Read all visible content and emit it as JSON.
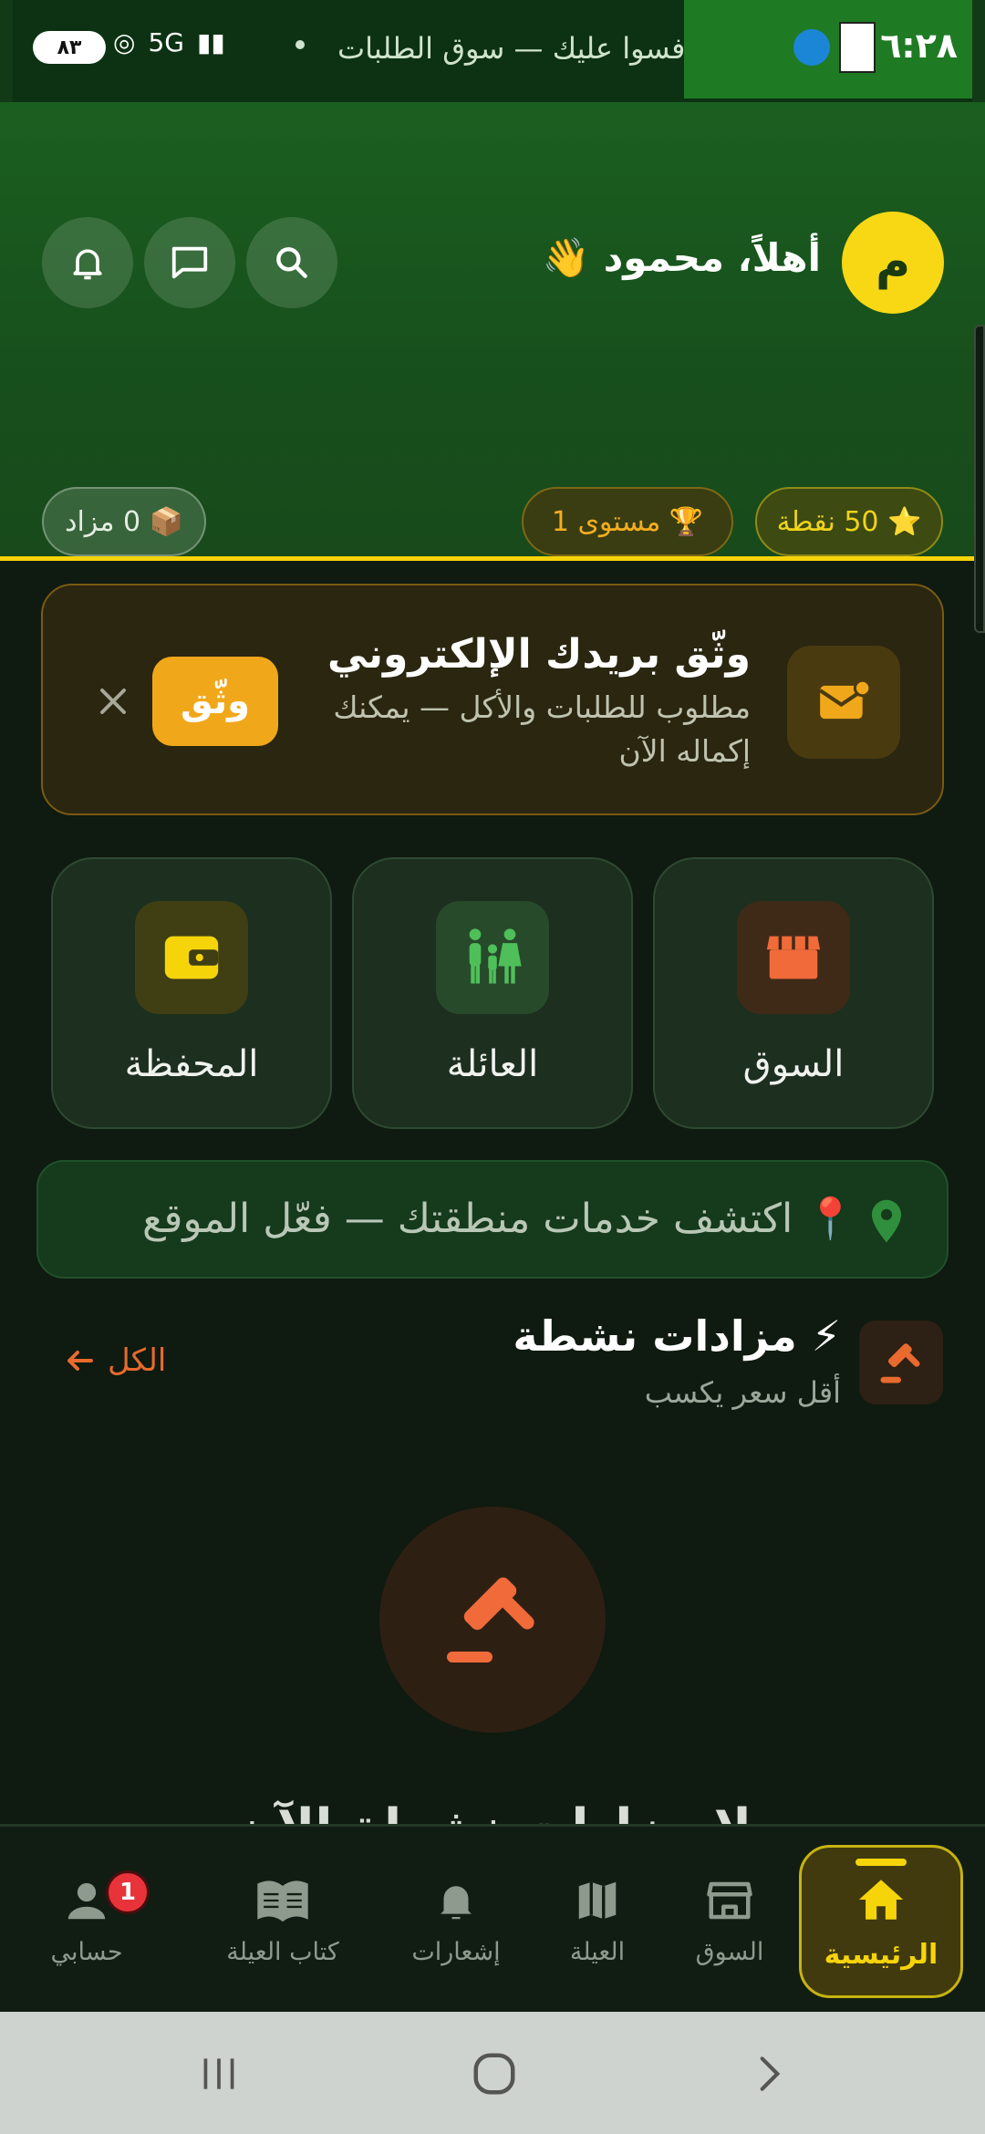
{
  "status_bar": {
    "time": "٦:٢٨",
    "notification_text": "فسوا عليك — سوق الطلبات",
    "battery": "٨٣"
  },
  "header": {
    "avatar_letter": "م",
    "greeting": "أهلاً، محمود 👋",
    "points_label": "⭐ 50 نقطة",
    "level_label": "🏆 مستوى 1",
    "auction_label": "📦 0 مزاد"
  },
  "verify_card": {
    "title": "وثّق بريدك الإلكتروني",
    "subtitle": "مطلوب للطلبات والأكل — يمكنك إكماله الآن",
    "button": "وثّق"
  },
  "tiles": [
    {
      "label": "السوق"
    },
    {
      "label": "العائلة"
    },
    {
      "label": "المحفظة"
    }
  ],
  "location": {
    "text": "📍 اكتشف خدمات منطقتك — فعّل الموقع"
  },
  "auctions": {
    "title": "⚡ مزادات نشطة",
    "subtitle": "أقل سعر يكسب",
    "see_all": "الكل",
    "empty_text": "لا مزادات نشطة الآن"
  },
  "bottom_nav": [
    {
      "label": "الرئيسية",
      "active": true
    },
    {
      "label": "السوق"
    },
    {
      "label": "العيلة"
    },
    {
      "label": "إشعارات"
    },
    {
      "label": "كتاب العيلة"
    },
    {
      "label": "حسابي",
      "badge": "1"
    }
  ],
  "colors": {
    "accent": "#f6d40a",
    "orange": "#f0a81a",
    "auction": "#e86a2e"
  }
}
